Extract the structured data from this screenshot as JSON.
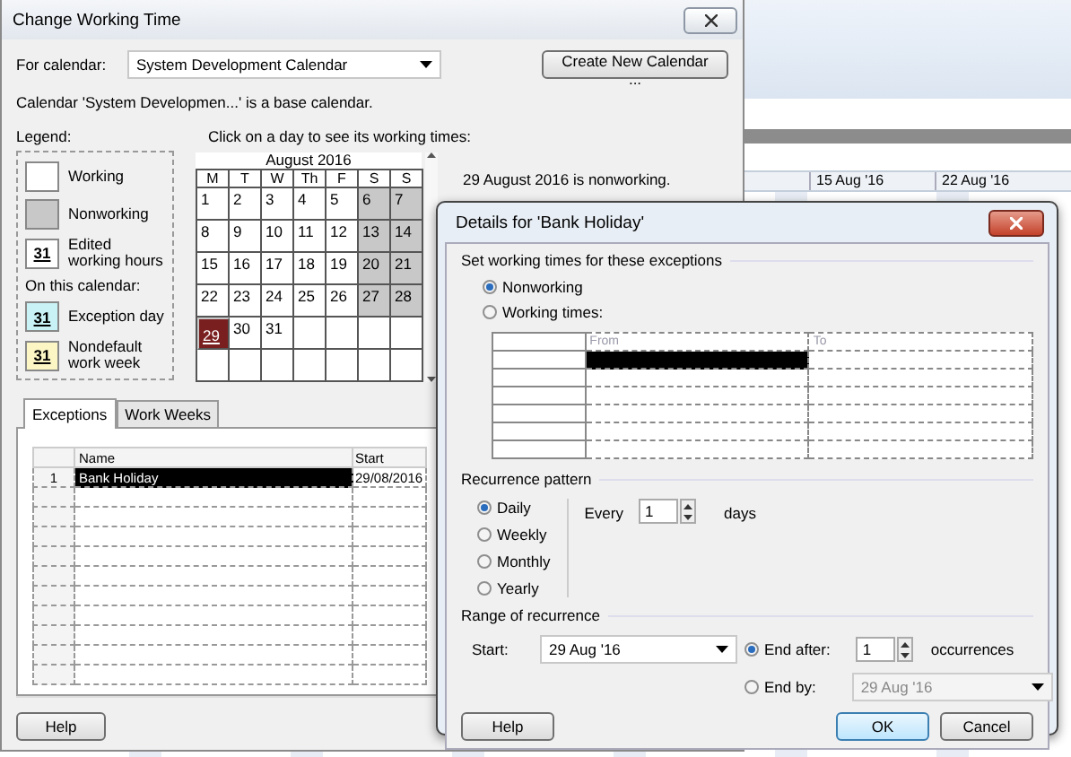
{
  "background": {
    "timescale": [
      "15 Aug '16",
      "22 Aug '16"
    ]
  },
  "main_window": {
    "title": "Change Working Time",
    "for_calendar": {
      "label": "For calendar:",
      "value": "System Development Calendar"
    },
    "create_button": "Create New Calendar ...",
    "note": "Calendar 'System Developmen...' is a base calendar.",
    "legend": {
      "title": "Legend:",
      "items": [
        {
          "kind": "working",
          "label": "Working"
        },
        {
          "kind": "nonworking",
          "label": "Nonworking"
        },
        {
          "kind": "edited",
          "label": "Edited working hours",
          "swatch": "31"
        }
      ],
      "subheading": "On this calendar:",
      "calendar_items": [
        {
          "kind": "exception",
          "label": "Exception day",
          "swatch": "31"
        },
        {
          "kind": "nondefault",
          "label": "Nondefault work week",
          "swatch": "31"
        }
      ]
    },
    "calendar": {
      "prompt": "Click on a day to see its working times:",
      "month": "August 2016",
      "weekdays": [
        "M",
        "T",
        "W",
        "Th",
        "F",
        "S",
        "S"
      ],
      "weeks": [
        [
          {
            "day": "1",
            "kind": "working",
            "selected": false
          },
          {
            "day": "2",
            "kind": "working",
            "selected": false
          },
          {
            "day": "3",
            "kind": "working",
            "selected": false
          },
          {
            "day": "4",
            "kind": "working",
            "selected": false
          },
          {
            "day": "5",
            "kind": "working",
            "selected": false
          },
          {
            "day": "6",
            "kind": "nonworking",
            "selected": false
          },
          {
            "day": "7",
            "kind": "nonworking",
            "selected": false
          }
        ],
        [
          {
            "day": "8",
            "kind": "working",
            "selected": false
          },
          {
            "day": "9",
            "kind": "working",
            "selected": false
          },
          {
            "day": "10",
            "kind": "working",
            "selected": false
          },
          {
            "day": "11",
            "kind": "working",
            "selected": false
          },
          {
            "day": "12",
            "kind": "working",
            "selected": false
          },
          {
            "day": "13",
            "kind": "nonworking",
            "selected": false
          },
          {
            "day": "14",
            "kind": "nonworking",
            "selected": false
          }
        ],
        [
          {
            "day": "15",
            "kind": "working",
            "selected": false
          },
          {
            "day": "16",
            "kind": "working",
            "selected": false
          },
          {
            "day": "17",
            "kind": "working",
            "selected": false
          },
          {
            "day": "18",
            "kind": "working",
            "selected": false
          },
          {
            "day": "19",
            "kind": "working",
            "selected": false
          },
          {
            "day": "20",
            "kind": "nonworking",
            "selected": false
          },
          {
            "day": "21",
            "kind": "nonworking",
            "selected": false
          }
        ],
        [
          {
            "day": "22",
            "kind": "working",
            "selected": false
          },
          {
            "day": "23",
            "kind": "working",
            "selected": false
          },
          {
            "day": "24",
            "kind": "working",
            "selected": false
          },
          {
            "day": "25",
            "kind": "working",
            "selected": false
          },
          {
            "day": "26",
            "kind": "working",
            "selected": false
          },
          {
            "day": "27",
            "kind": "nonworking",
            "selected": false
          },
          {
            "day": "28",
            "kind": "nonworking",
            "selected": false
          }
        ],
        [
          {
            "day": "29",
            "kind": "exception",
            "selected": true
          },
          {
            "day": "30",
            "kind": "working",
            "selected": false
          },
          {
            "day": "31",
            "kind": "working",
            "selected": false
          }
        ]
      ],
      "status": "29 August 2016 is nonworking."
    },
    "tabs": [
      {
        "label": "Exceptions",
        "selected": true
      },
      {
        "label": "Work Weeks",
        "selected": false
      }
    ],
    "exceptions": {
      "columns": [
        "Name",
        "Start"
      ],
      "rows": [
        {
          "number": "1",
          "name": "Bank Holiday",
          "start": "29/08/2016",
          "selected": true
        }
      ]
    },
    "help_button": "Help"
  },
  "details_window": {
    "title": "Details for 'Bank Holiday'",
    "times_section": "Set working times for these exceptions",
    "time_modes": [
      {
        "label": "Nonworking",
        "selected": true
      },
      {
        "label": "Working times:",
        "selected": false
      }
    ],
    "times_table": {
      "columns": [
        "From",
        "To"
      ],
      "rows": [
        {
          "selected": true
        },
        {
          "selected": false
        },
        {
          "selected": false
        },
        {
          "selected": false
        },
        {
          "selected": false
        },
        {
          "selected": false
        }
      ]
    },
    "recurrence_section": "Recurrence pattern",
    "patterns": [
      {
        "label": "Daily",
        "selected": true
      },
      {
        "label": "Weekly",
        "selected": false
      },
      {
        "label": "Monthly",
        "selected": false
      },
      {
        "label": "Yearly",
        "selected": false
      }
    ],
    "every": {
      "label": "Every",
      "value": "1",
      "unit": "days"
    },
    "range_section": "Range of recurrence",
    "start": {
      "label": "Start:",
      "value": "29 Aug '16"
    },
    "end_after": {
      "label": "End after:",
      "selected": true,
      "value": "1",
      "unit": "occurrences"
    },
    "end_by": {
      "label": "End by:",
      "selected": false,
      "value": "29 Aug '16"
    },
    "buttons": {
      "help": "Help",
      "ok": "OK",
      "cancel": "Cancel"
    }
  }
}
